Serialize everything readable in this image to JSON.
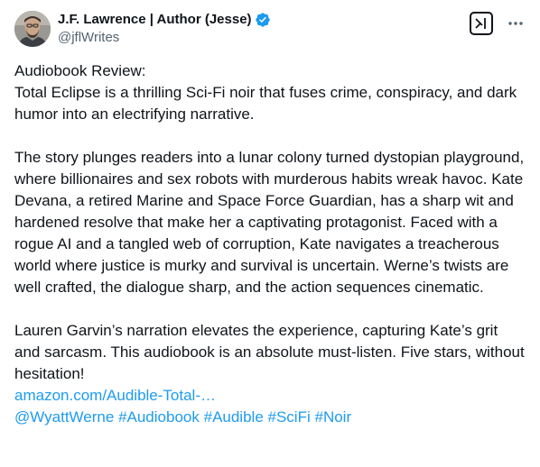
{
  "author": {
    "display_name": "J.F. Lawrence | Author (Jesse)",
    "handle": "@jflWrites",
    "verified": true
  },
  "icons": {
    "verified": "verified-badge-icon",
    "grok": "grok-icon",
    "more": "more-options-icon"
  },
  "colors": {
    "text": "#0f1419",
    "secondary": "#536471",
    "accent": "#1d9bf0"
  },
  "tweet": {
    "line1": "Audiobook Review:",
    "line2": "Total Eclipse is a thrilling Sci-Fi noir that fuses crime, conspiracy, and dark humor into an electrifying narrative.",
    "para2": "The story plunges readers into a lunar colony turned dystopian playground, where billionaires and sex robots with murderous habits wreak havoc. Kate Devana, a retired Marine and Space Force Guardian, has a sharp wit and hardened resolve that make her a captivating protagonist. Faced with a rogue AI and a tangled web of corruption, Kate navigates a treacherous world where justice is murky and survival is uncertain. Werne’s twists are well crafted, the dialogue sharp, and the action sequences cinematic.",
    "para3": "Lauren Garvin’s narration elevates the experience, capturing Kate’s grit and sarcasm. This audiobook is an absolute must-listen. Five stars, without hesitation!",
    "link": "amazon.com/Audible-Total-…",
    "hashtags": [
      "@WyattWerne",
      "#Audiobook",
      "#Audible",
      "#SciFi",
      "#Noir"
    ]
  }
}
